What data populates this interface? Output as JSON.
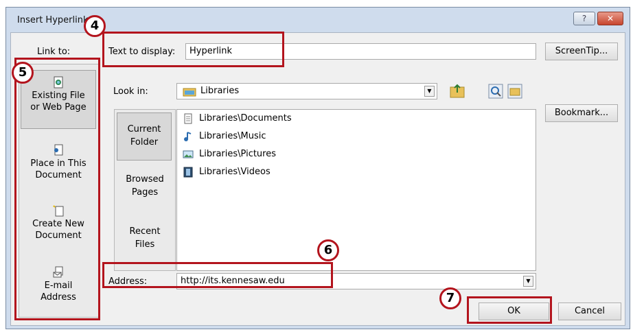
{
  "window": {
    "title": "Insert Hyperlink"
  },
  "link_to": {
    "label": "Link to:",
    "items": [
      {
        "line1": "Existing File",
        "line2": "or Web Page",
        "icon": "existing-file-icon"
      },
      {
        "line1": "Place in This",
        "line2": "Document",
        "icon": "place-in-document-icon"
      },
      {
        "line1": "Create New",
        "line2": "Document",
        "icon": "create-new-document-icon"
      },
      {
        "line1": "E-mail",
        "line2": "Address",
        "icon": "email-address-icon"
      }
    ]
  },
  "text_to_display": {
    "label": "Text to display:",
    "value": "Hyperlink"
  },
  "screentip_label": "ScreenTip...",
  "look_in": {
    "label": "Look in:",
    "value": "Libraries"
  },
  "bookmark_label": "Bookmark...",
  "views": [
    {
      "line1": "Current",
      "line2": "Folder"
    },
    {
      "line1": "Browsed",
      "line2": "Pages"
    },
    {
      "line1": "Recent",
      "line2": "Files"
    }
  ],
  "files": [
    {
      "name": "Libraries\\Documents",
      "icon": "documents-library-icon"
    },
    {
      "name": "Libraries\\Music",
      "icon": "music-library-icon"
    },
    {
      "name": "Libraries\\Pictures",
      "icon": "pictures-library-icon"
    },
    {
      "name": "Libraries\\Videos",
      "icon": "videos-library-icon"
    }
  ],
  "address": {
    "label": "Address:",
    "value": "http://its.kennesaw.edu"
  },
  "ok_label": "OK",
  "cancel_label": "Cancel",
  "callouts": {
    "c4": "4",
    "c5": "5",
    "c6": "6",
    "c7": "7"
  },
  "colors": {
    "callout": "#b3141d",
    "window_frame": "#cfdced"
  }
}
